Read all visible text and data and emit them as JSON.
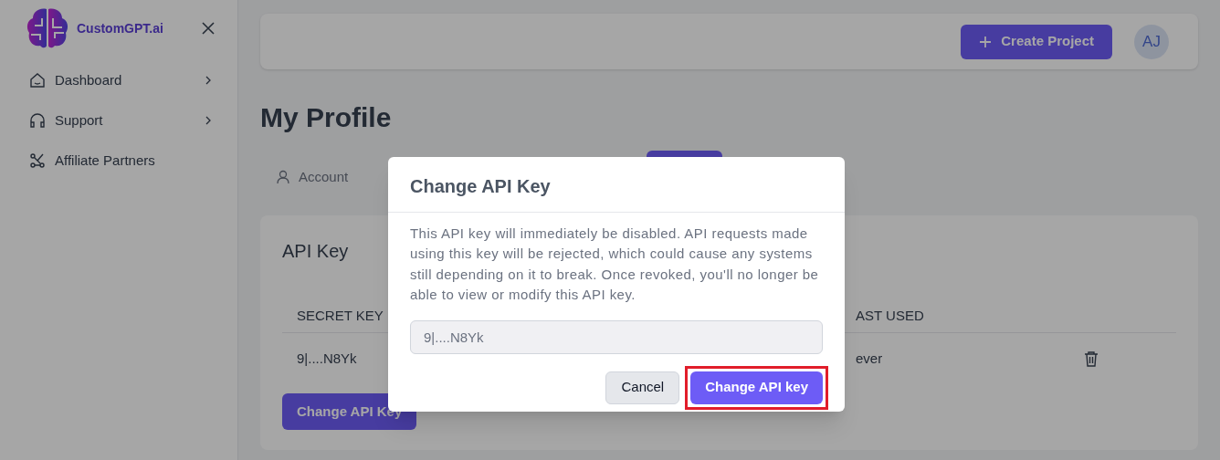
{
  "sidebar": {
    "brand": "CustomGPT.ai",
    "items": [
      {
        "label": "Dashboard",
        "has_submenu": true
      },
      {
        "label": "Support",
        "has_submenu": true
      },
      {
        "label": "Affiliate Partners",
        "has_submenu": false
      }
    ]
  },
  "header": {
    "create_button": "Create Project",
    "avatar": "AJ"
  },
  "page_title": "My Profile",
  "tabs": [
    {
      "label": "Account",
      "selected": false
    }
  ],
  "api_card": {
    "title": "API Key",
    "columns": [
      "SECRET KEY",
      "AST USED"
    ],
    "rows": [
      [
        "9|....N8Yk",
        "ever"
      ]
    ],
    "button": "Change API Key"
  },
  "dialog": {
    "title": "Change API Key",
    "message": "This API key will immediately be disabled. API requests made using this key will be rejected, which could cause any systems still depending on it to break. Once revoked, you'll no longer be able to view or modify this API key.",
    "key_value": "9|....N8Yk",
    "buttons": [
      {
        "label": "Cancel",
        "kind": "secondary"
      },
      {
        "label": "Change API key",
        "kind": "primary",
        "highlighted": true
      }
    ]
  }
}
